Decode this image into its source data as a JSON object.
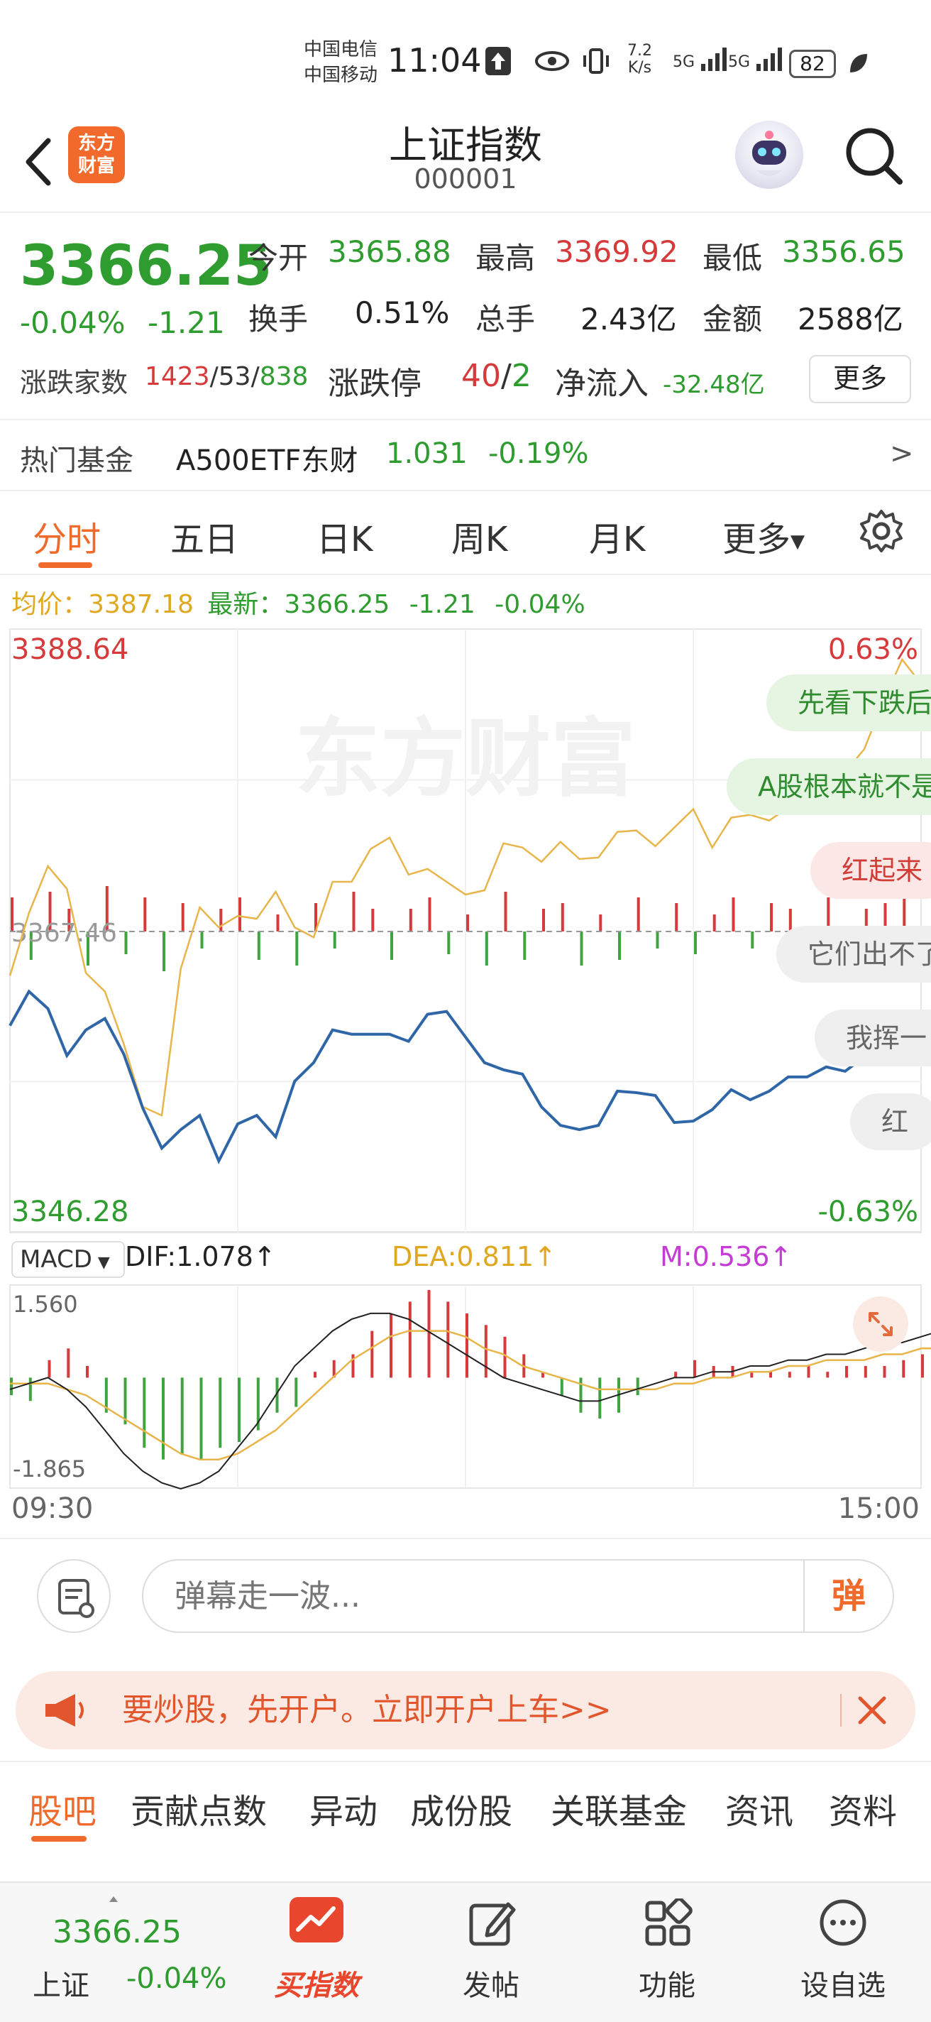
{
  "status_bar": {
    "carrier_1": "中国电信",
    "carrier_2": "中国移动",
    "time": "11:04",
    "speed_value": "7.2",
    "speed_unit": "K/s",
    "signal_1": "5G",
    "signal_2": "5G",
    "battery": "82"
  },
  "header": {
    "title": "上证指数",
    "code": "000001",
    "logo_line1": "东方",
    "logo_line2": "财富"
  },
  "quote": {
    "last": "3366.25",
    "pct": "-0.04%",
    "chg": "-1.21",
    "open_label": "今开",
    "open": "3365.88",
    "high_label": "最高",
    "high": "3369.92",
    "low_label": "最低",
    "low": "3356.65",
    "turnover_label": "换手",
    "turnover": "0.51%",
    "volume_label": "总手",
    "volume": "2.43亿",
    "amount_label": "金额",
    "amount": "2588亿",
    "breadth_label": "涨跌家数",
    "up": "1423",
    "flat": "53",
    "down": "838",
    "limit_label": "涨跌停",
    "limit_up": "40",
    "limit_down": "2",
    "netflow_label": "净流入",
    "netflow": "-32.48亿",
    "more": "更多"
  },
  "fund": {
    "label": "热门基金",
    "name": "A500ETF东财",
    "price": "1.031",
    "pct": "-0.19%",
    "arrow": ">"
  },
  "period_tabs": [
    "分时",
    "五日",
    "日K",
    "周K",
    "月K",
    "更多"
  ],
  "avg": {
    "avg_label": "均价：",
    "avg_value": "3387.18",
    "latest_label": "最新：",
    "latest_value": "3366.25",
    "chg": "-1.21",
    "pct": "-0.04%"
  },
  "chart_data": {
    "type": "line",
    "y_max": "3388.64",
    "y_min": "3346.28",
    "y_max_pct": "0.63%",
    "y_min_pct": "-0.63%",
    "prev_close": "3367.46",
    "x_start": "09:30",
    "x_end": "15:00",
    "watermark": "东方财富",
    "ylim": [
      3346.28,
      3388.64
    ],
    "series": [
      {
        "color": "#2f66a8",
        "values": [
          3360.8,
          3363.2,
          3362.0,
          3358.7,
          3360.5,
          3361.3,
          3358.8,
          3355.0,
          3352.2,
          3353.5,
          3354.5,
          3351.3,
          3353.9,
          3354.5,
          3353.0,
          3356.9,
          3358.2,
          3360.5,
          3360.2,
          3360.2,
          3360.2,
          3359.7,
          3361.6,
          3361.8,
          3360.0,
          3358.2,
          3357.7,
          3357.4,
          3355.1,
          3353.8,
          3353.5,
          3353.8,
          3356.2,
          3356.1,
          3355.9,
          3354.0,
          3354.1,
          3354.9,
          3356.3,
          3355.6,
          3356.2,
          3357.2,
          3357.2,
          3357.9,
          3357.6,
          3358.6,
          3358.2,
          3359.0,
          3359.9,
          3362.2,
          3362.7,
          3362.6,
          3363.5,
          3364.9,
          3366.25
        ]
      },
      {
        "color": "#e8b54a",
        "values": [
          3364.3,
          3368.7,
          3372.0,
          3370.4,
          3364.5,
          3363.2,
          3359.5,
          3355.1,
          3354.5,
          3364.8,
          3369.1,
          3367.7,
          3368.5,
          3368.3,
          3370.2,
          3367.7,
          3367.0,
          3370.9,
          3370.9,
          3373.2,
          3374.0,
          3371.4,
          3371.8,
          3370.9,
          3370.0,
          3370.3,
          3373.6,
          3373.3,
          3372.3,
          3373.7,
          3372.5,
          3372.6,
          3374.4,
          3374.5,
          3373.4,
          3374.7,
          3376.0,
          3373.3,
          3375.4,
          3375.6,
          3375.2,
          3376.1,
          3377.0,
          3377.0,
          3378.6,
          3380.2,
          3383.5,
          3386.5,
          3384.8,
          3385.0,
          3383.3,
          3382.4,
          3384.0,
          3386.5,
          3387.18
        ]
      }
    ],
    "macd": {
      "label": "MACD",
      "dif": "DIF:1.078",
      "dea": "DEA:0.811",
      "m": "M:0.536",
      "top": "1.560",
      "bottom": "-1.865",
      "ylim": [
        -1.865,
        1.56
      ],
      "bars": [
        -0.3,
        -0.4,
        0.3,
        0.5,
        0.2,
        -0.6,
        -0.8,
        -1.2,
        -1.4,
        -1.3,
        -1.4,
        -1.2,
        -1.1,
        -0.9,
        -0.6,
        -0.5,
        0.1,
        0.3,
        0.4,
        0.8,
        1.1,
        1.3,
        1.5,
        1.3,
        1.1,
        0.9,
        0.7,
        0.4,
        0.1,
        -0.3,
        -0.6,
        -0.7,
        -0.6,
        -0.3,
        0.0,
        0.1,
        0.3,
        0.2,
        0.2,
        0.1,
        0.1,
        0.1,
        0.2,
        0.1,
        0.2,
        0.2,
        0.2,
        0.3,
        0.4,
        0.4,
        0.5,
        0.5,
        0.4,
        0.5,
        0.5
      ],
      "dif_values": [
        -0.2,
        -0.1,
        0.0,
        -0.2,
        -0.5,
        -0.9,
        -1.3,
        -1.6,
        -1.8,
        -1.9,
        -1.8,
        -1.6,
        -1.2,
        -0.8,
        -0.3,
        0.2,
        0.5,
        0.8,
        1.0,
        1.1,
        1.1,
        1.0,
        0.8,
        0.6,
        0.4,
        0.2,
        0.0,
        -0.1,
        -0.2,
        -0.3,
        -0.4,
        -0.4,
        -0.3,
        -0.2,
        -0.1,
        0.0,
        0.0,
        0.1,
        0.1,
        0.2,
        0.2,
        0.3,
        0.3,
        0.4,
        0.4,
        0.5,
        0.6,
        0.6,
        0.7,
        0.8,
        0.8,
        0.9,
        1.0,
        1.0,
        1.1
      ],
      "dea_values": [
        -0.1,
        -0.1,
        -0.1,
        -0.2,
        -0.3,
        -0.5,
        -0.7,
        -0.9,
        -1.1,
        -1.3,
        -1.4,
        -1.4,
        -1.3,
        -1.1,
        -0.9,
        -0.6,
        -0.3,
        0.0,
        0.3,
        0.5,
        0.7,
        0.8,
        0.8,
        0.8,
        0.7,
        0.5,
        0.4,
        0.2,
        0.1,
        0.0,
        -0.1,
        -0.2,
        -0.2,
        -0.2,
        -0.2,
        -0.1,
        -0.1,
        0.0,
        0.0,
        0.1,
        0.1,
        0.2,
        0.2,
        0.3,
        0.3,
        0.3,
        0.4,
        0.4,
        0.5,
        0.5,
        0.6,
        0.6,
        0.7,
        0.7,
        0.8
      ]
    },
    "volume_bars": [
      0.6,
      -0.5,
      0.7,
      0.4,
      -0.6,
      0.8,
      -0.4,
      0.6,
      -0.7,
      0.5,
      -0.3,
      0.4,
      0.6,
      -0.5,
      0.3,
      -0.6,
      0.5,
      -0.3,
      0.7,
      0.4,
      -0.5,
      0.4,
      0.6,
      -0.4,
      0.3,
      -0.6,
      0.7,
      -0.5,
      0.4,
      0.5,
      -0.6,
      0.3,
      -0.5,
      0.6,
      -0.3,
      0.5,
      -0.4,
      0.3,
      0.6,
      -0.3,
      0.5,
      0.4,
      -0.4,
      0.6,
      -0.3,
      0.4,
      0.5,
      0.9,
      -0.5,
      0.6,
      -0.6,
      0.4,
      -0.5,
      0.6,
      0.8
    ]
  },
  "danmu": [
    {
      "text": "先看下跌后",
      "tone": "g"
    },
    {
      "text": "A股根本就不是",
      "tone": "g"
    },
    {
      "text": "红起来",
      "tone": "r"
    },
    {
      "text": "它们出不了",
      "tone": "n"
    },
    {
      "text": "我挥一",
      "tone": "n"
    },
    {
      "text": "红",
      "tone": "n"
    }
  ],
  "comment": {
    "placeholder": "弹幕走一波...",
    "send": "弹"
  },
  "promo": {
    "text": "要炒股，先开户。立即开户上车>>"
  },
  "section_tabs": [
    "股吧",
    "贡献点数",
    "异动",
    "成份股",
    "关联基金",
    "资讯",
    "资料"
  ],
  "bottom_nav": {
    "index_value": "3366.25",
    "index_name": "上证",
    "index_pct": "-0.04%",
    "buy": "买指数",
    "post": "发帖",
    "func": "功能",
    "watch": "设自选"
  },
  "colors": {
    "accent": "#f06a2b",
    "up": "#d63a3a",
    "down": "#2f9c2f"
  }
}
